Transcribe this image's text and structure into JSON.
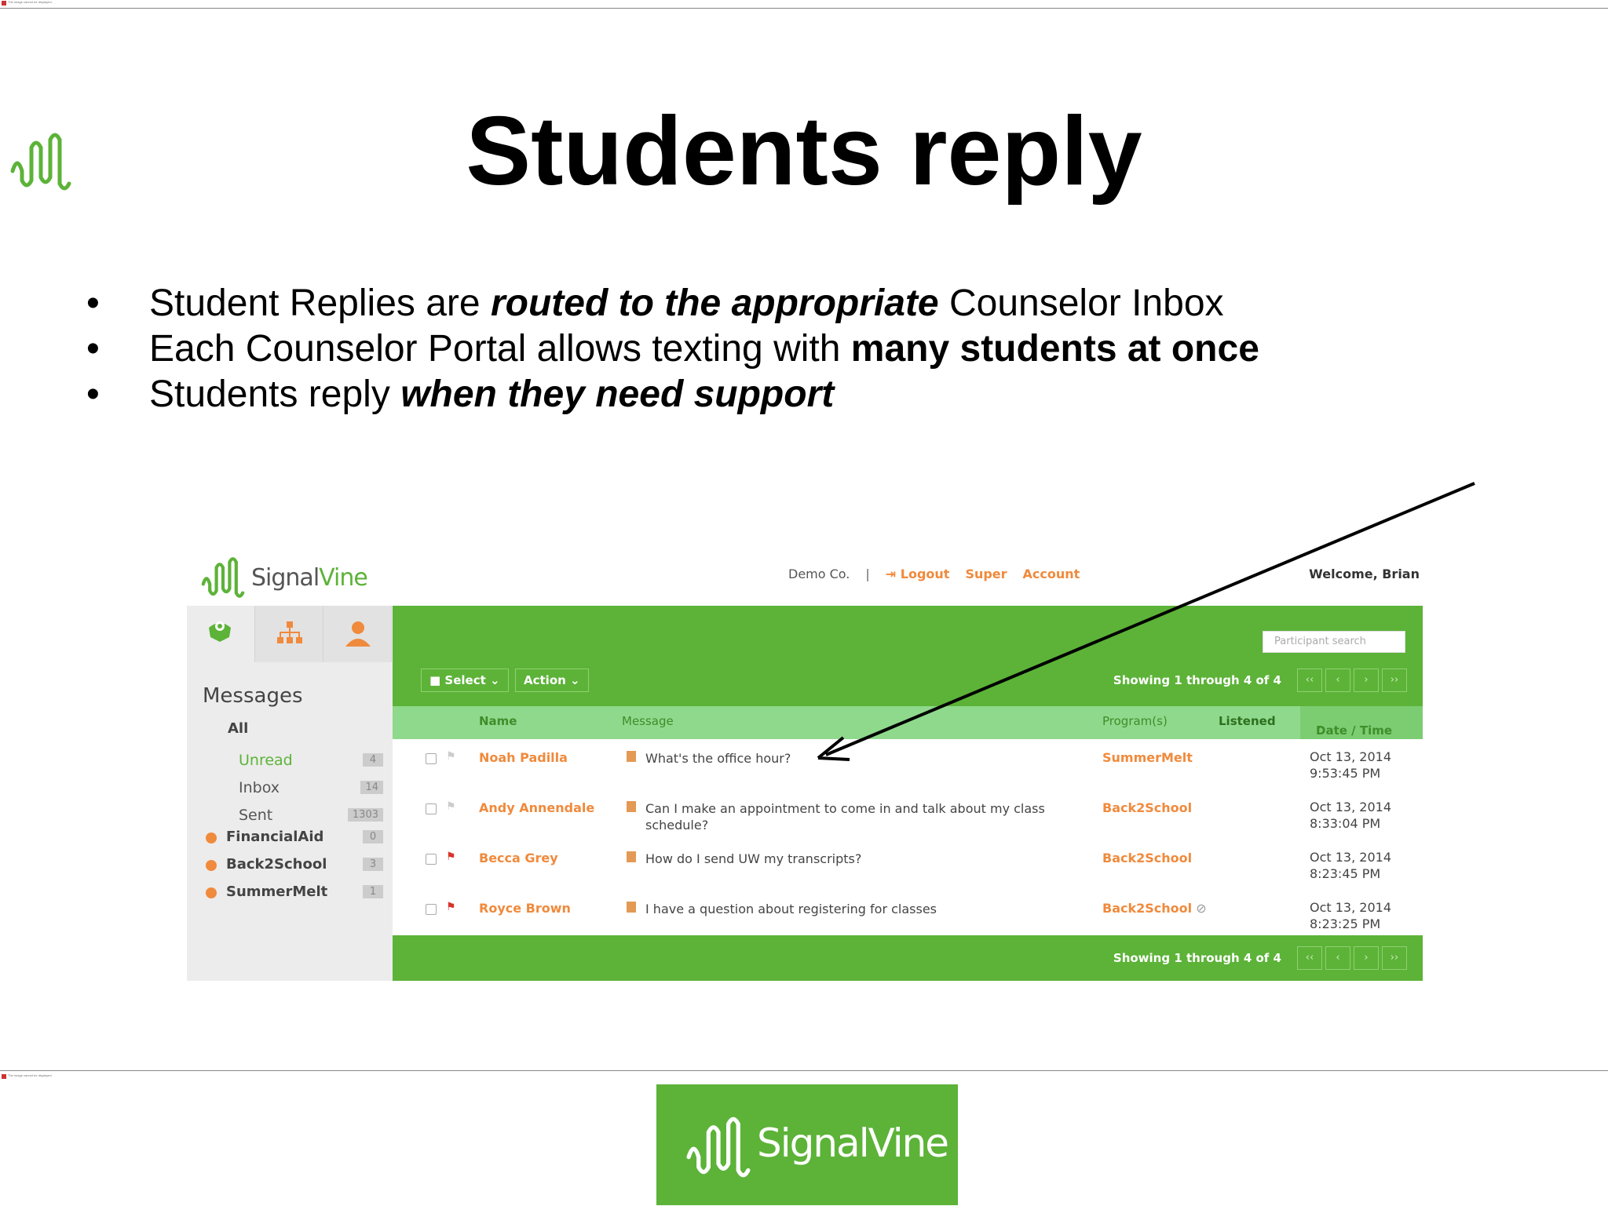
{
  "slide": {
    "title": "Students reply",
    "bullets": [
      {
        "pre": "Student Replies are ",
        "em": "routed to the appropriate",
        "post": " Counselor Inbox"
      },
      {
        "pre": "Each Counselor Portal allows texting with ",
        "strong": "many students at once"
      },
      {
        "pre": "Students reply ",
        "em": "when they need support"
      }
    ],
    "broken_image_text": "The image cannot be displayed."
  },
  "app": {
    "logo": {
      "brand_a": "Signal",
      "brand_b": "Vine"
    },
    "topnav": {
      "org": "Demo Co.",
      "separator": "|",
      "logout": "Logout",
      "super": "Super",
      "account": "Account"
    },
    "welcome": "Welcome, Brian",
    "sidebar": {
      "title": "Messages",
      "all": "All",
      "folders": [
        {
          "label": "Unread",
          "count": "4"
        },
        {
          "label": "Inbox",
          "count": "14"
        },
        {
          "label": "Sent",
          "count": "1303"
        }
      ],
      "programs": [
        {
          "label": "FinancialAid",
          "count": "0"
        },
        {
          "label": "Back2School",
          "count": "3"
        },
        {
          "label": "SummerMelt",
          "count": "1"
        }
      ]
    },
    "toolbar": {
      "search_placeholder": "Participant search",
      "select": "Select",
      "action": "Action",
      "showing": "Showing 1 through 4 of 4",
      "pager": [
        "‹‹",
        "‹",
        "›",
        "››"
      ]
    },
    "table": {
      "headers": {
        "name": "Name",
        "message": "Message",
        "programs": "Program(s)",
        "listened": "Listened",
        "datetime": "Date / Time"
      },
      "rows": [
        {
          "name": "Noah Padilla",
          "message": "What's the office hour?",
          "program": "SummerMelt",
          "date": "Oct 13, 2014",
          "time": "9:53:45 PM",
          "flag": "#cccccc"
        },
        {
          "name": "Andy Annendale",
          "message": "Can I make an appointment to come in and talk about my class schedule?",
          "program": "Back2School",
          "date": "Oct 13, 2014",
          "time": "8:33:04 PM",
          "flag": "#cccccc"
        },
        {
          "name": "Becca Grey",
          "message": "How do I send UW my transcripts?",
          "program": "Back2School",
          "date": "Oct 13, 2014",
          "time": "8:23:45 PM",
          "flag": "#d9332b"
        },
        {
          "name": "Royce Brown",
          "message": "I have a question about registering for classes",
          "program": "Back2School",
          "date": "Oct 13, 2014",
          "time": "8:23:25 PM",
          "flag": "#d9332b"
        }
      ]
    }
  },
  "footer": {
    "brand": "SignalVine"
  },
  "colors": {
    "green": "#5cb338",
    "orange": "#f08a3c",
    "light_green": "#8fd98c"
  }
}
